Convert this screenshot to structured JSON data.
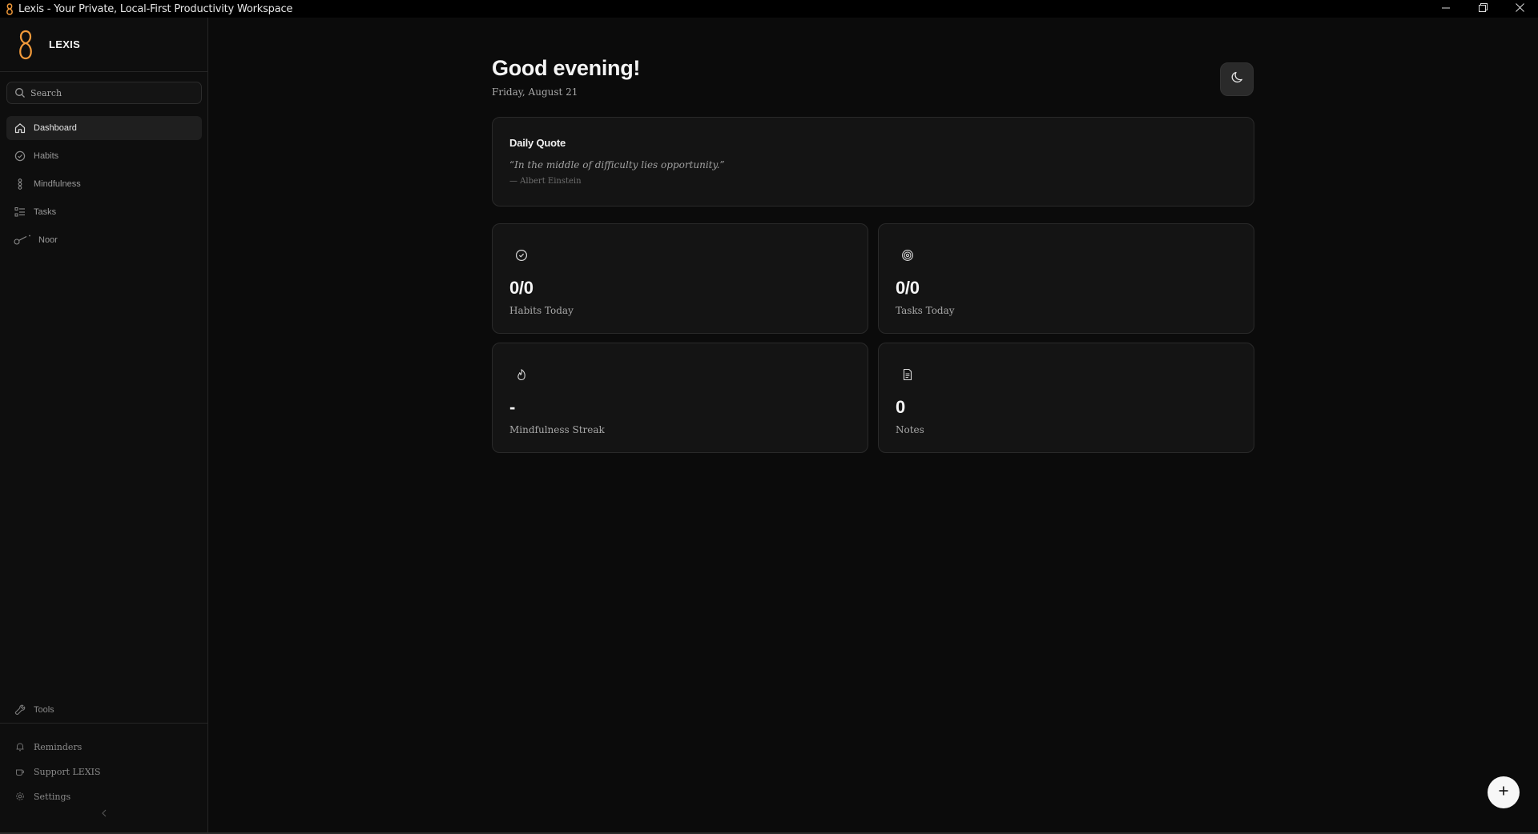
{
  "window": {
    "title": "Lexis - Your Private, Local-First Productivity Workspace",
    "controls": [
      "minimize-icon",
      "restore-icon",
      "close-icon"
    ]
  },
  "colors": {
    "accent": "#f29a3a",
    "background": "#0b0b0b",
    "sidebar": "#0e0e0e",
    "card": "#141414"
  },
  "sidebar": {
    "brand": "LEXIS",
    "search": {
      "placeholder": "Search",
      "value": ""
    },
    "items": [
      {
        "label": "Dashboard",
        "icon": "home-icon",
        "active": true
      },
      {
        "label": "Habits",
        "icon": "check-circle-icon",
        "active": false
      },
      {
        "label": "Mindfulness",
        "icon": "bead-icon",
        "active": false
      },
      {
        "label": "Tasks",
        "icon": "list-check-icon",
        "active": false
      },
      {
        "label": "Noor",
        "icon": "noor-icon",
        "active": false
      }
    ],
    "tools": {
      "label": "Tools",
      "icon": "wrench-icon"
    },
    "footer": [
      {
        "label": "Reminders",
        "icon": "bell-icon"
      },
      {
        "label": "Support LEXIS",
        "icon": "coffee-icon"
      },
      {
        "label": "Settings",
        "icon": "gear-icon"
      }
    ]
  },
  "header": {
    "greeting": "Good evening!",
    "date": "Friday, August 21"
  },
  "quote": {
    "title": "Daily Quote",
    "text": "“In the middle of difficulty lies opportunity.”",
    "author": "— Albert Einstein"
  },
  "stats": [
    {
      "value": "0/0",
      "label": "Habits Today",
      "icon": "check-circle-icon"
    },
    {
      "value": "0/0",
      "label": "Tasks Today",
      "icon": "target-icon"
    },
    {
      "value": "-",
      "label": "Mindfulness Streak",
      "icon": "flame-icon"
    },
    {
      "value": "0",
      "label": "Notes",
      "icon": "document-icon"
    }
  ]
}
